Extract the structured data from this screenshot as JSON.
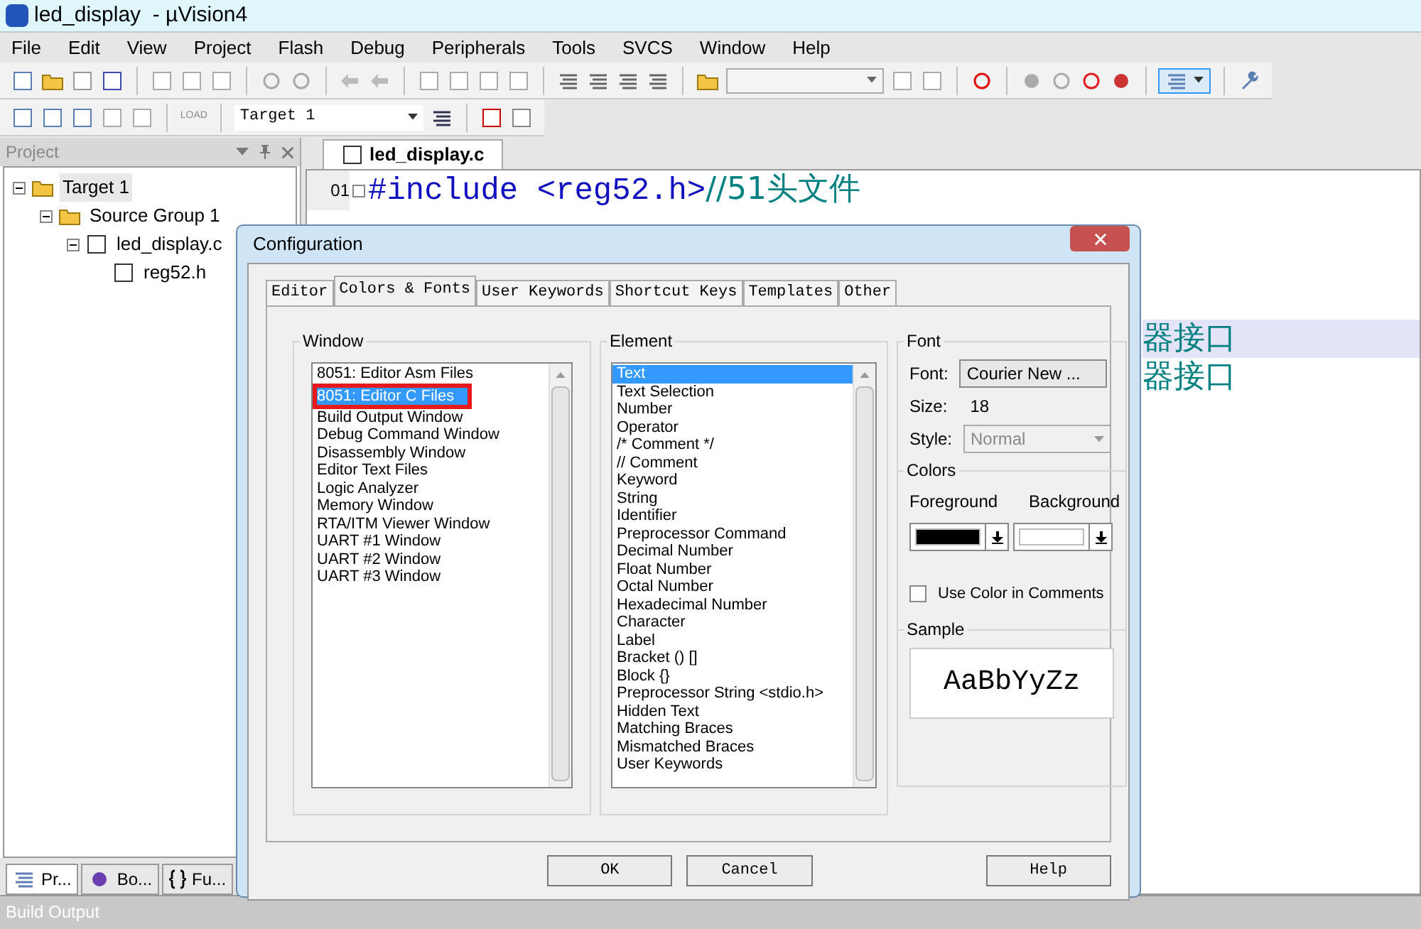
{
  "window": {
    "title": "led_display  - µVision4"
  },
  "menu": [
    "File",
    "Edit",
    "View",
    "Project",
    "Flash",
    "Debug",
    "Peripherals",
    "Tools",
    "SVCS",
    "Window",
    "Help"
  ],
  "build_toolbar": {
    "target": "Target 1",
    "load_label": "LOAD"
  },
  "project_panel": {
    "title": "Project",
    "tree": [
      {
        "label": "Target 1",
        "kind": "target",
        "selected": true,
        "children": [
          {
            "label": "Source Group 1",
            "kind": "group",
            "selected": false,
            "children": [
              {
                "label": "led_display.c",
                "kind": "source",
                "selected": false,
                "children": [
                  {
                    "label": "reg52.h",
                    "kind": "header",
                    "selected": false
                  }
                ]
              }
            ]
          }
        ]
      }
    ],
    "bottom_tabs": [
      {
        "label": "Pr...",
        "kind": "project",
        "selected": true
      },
      {
        "label": "Bo...",
        "kind": "books",
        "selected": false
      },
      {
        "label": "Fu...",
        "kind": "functions",
        "selected": false
      }
    ]
  },
  "editor": {
    "tab": "led_display.c",
    "lines": [
      {
        "number": "01",
        "code": "#include <reg52.h>",
        "comment": "//51头文件"
      }
    ],
    "fragments": [
      {
        "text": "器接口",
        "highlighted": true
      },
      {
        "text": "器接口",
        "highlighted": false
      }
    ]
  },
  "dialog": {
    "title": "Configuration",
    "tabs": [
      {
        "label": "Editor",
        "selected": false
      },
      {
        "label": "Colors & Fonts",
        "selected": true
      },
      {
        "label": "User Keywords",
        "selected": false
      },
      {
        "label": "Shortcut Keys",
        "selected": false
      },
      {
        "label": "Templates",
        "selected": false
      },
      {
        "label": "Other",
        "selected": false
      }
    ],
    "window_group": {
      "title": "Window",
      "items": [
        {
          "label": "8051: Editor Asm Files",
          "selected": false,
          "marked": false
        },
        {
          "label": "8051: Editor C Files",
          "selected": true,
          "marked": true
        },
        {
          "label": "Build Output Window",
          "selected": false,
          "marked": false
        },
        {
          "label": "Debug Command Window",
          "selected": false,
          "marked": false
        },
        {
          "label": "Disassembly Window",
          "selected": false,
          "marked": false
        },
        {
          "label": "Editor Text Files",
          "selected": false,
          "marked": false
        },
        {
          "label": "Logic Analyzer",
          "selected": false,
          "marked": false
        },
        {
          "label": "Memory Window",
          "selected": false,
          "marked": false
        },
        {
          "label": "RTA/ITM Viewer Window",
          "selected": false,
          "marked": false
        },
        {
          "label": "UART #1 Window",
          "selected": false,
          "marked": false
        },
        {
          "label": "UART #2 Window",
          "selected": false,
          "marked": false
        },
        {
          "label": "UART #3 Window",
          "selected": false,
          "marked": false
        }
      ]
    },
    "element_group": {
      "title": "Element",
      "items": [
        {
          "label": "Text",
          "selected": true
        },
        {
          "label": "Text Selection",
          "selected": false
        },
        {
          "label": "Number",
          "selected": false
        },
        {
          "label": "Operator",
          "selected": false
        },
        {
          "label": "/* Comment */",
          "selected": false
        },
        {
          "label": "// Comment",
          "selected": false
        },
        {
          "label": "Keyword",
          "selected": false
        },
        {
          "label": "String",
          "selected": false
        },
        {
          "label": "Identifier",
          "selected": false
        },
        {
          "label": "Preprocessor Command",
          "selected": false
        },
        {
          "label": "Decimal Number",
          "selected": false
        },
        {
          "label": "Float Number",
          "selected": false
        },
        {
          "label": "Octal Number",
          "selected": false
        },
        {
          "label": "Hexadecimal Number",
          "selected": false
        },
        {
          "label": "Character",
          "selected": false
        },
        {
          "label": "Label",
          "selected": false
        },
        {
          "label": "Bracket () []",
          "selected": false
        },
        {
          "label": "Block {}",
          "selected": false
        },
        {
          "label": "Preprocessor String <stdio.h>",
          "selected": false
        },
        {
          "label": "Hidden Text",
          "selected": false
        },
        {
          "label": "Matching Braces",
          "selected": false
        },
        {
          "label": "Mismatched Braces",
          "selected": false
        },
        {
          "label": "User Keywords",
          "selected": false
        }
      ]
    },
    "font_group": {
      "title": "Font",
      "font_label": "Font:",
      "font_button": "Courier New ...",
      "size_label": "Size:",
      "size": "18",
      "style_label": "Style:",
      "style": "Normal",
      "style_disabled": true
    },
    "colors_group": {
      "title": "Colors",
      "foreground_label": "Foreground",
      "background_label": "Background",
      "foreground": {
        "color": "#000000"
      },
      "background": {
        "color": "#ffffff"
      },
      "use_color_in_comments": {
        "label": "Use Color in Comments",
        "checked": false
      }
    },
    "sample_group": {
      "title": "Sample",
      "text": "AaBbYyZz"
    },
    "buttons": [
      "OK",
      "Cancel",
      "Help"
    ]
  },
  "build_output": {
    "title": "Build Output"
  }
}
